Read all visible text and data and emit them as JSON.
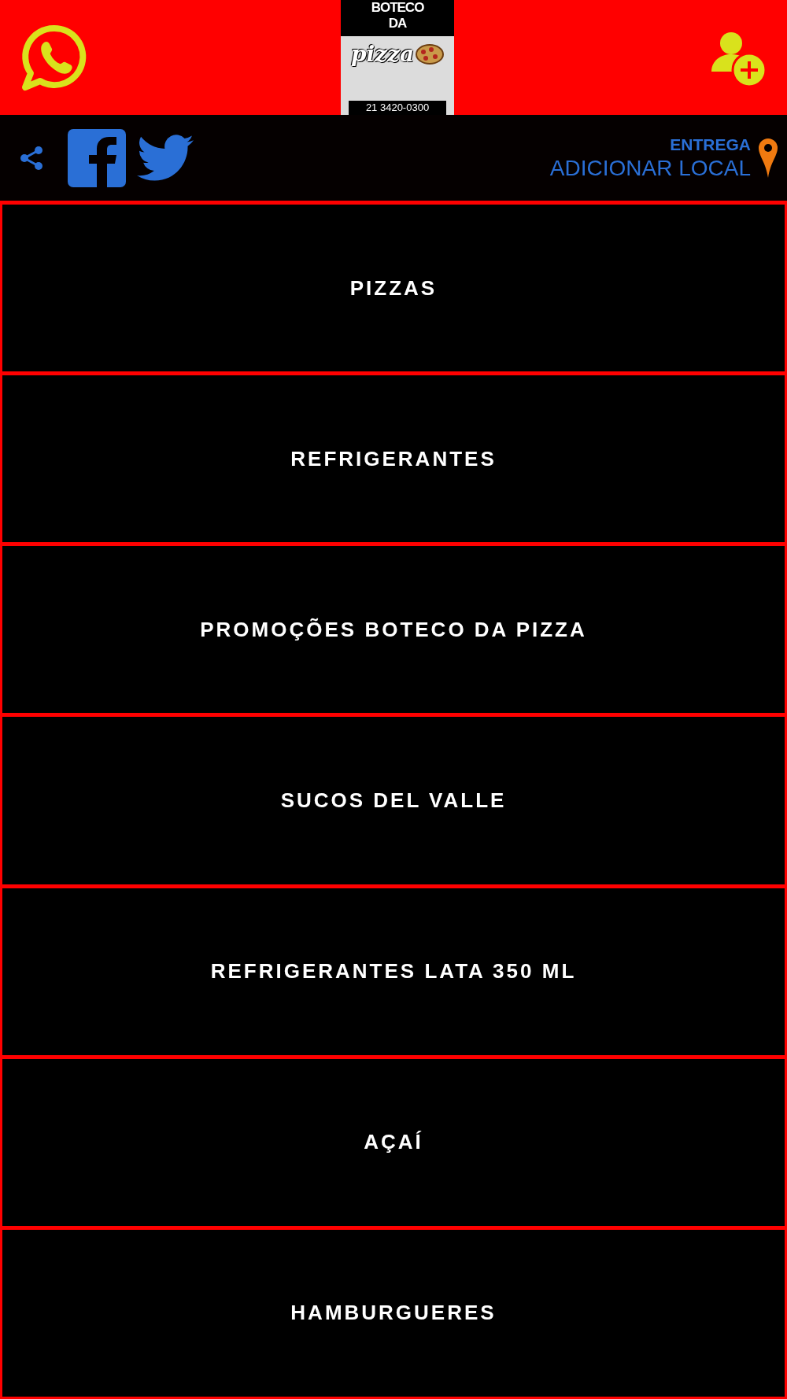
{
  "header": {
    "logo": {
      "top_lines": [
        "BOTECO",
        "DA"
      ],
      "wordmark": "pizza",
      "phone": "21 3420-0300"
    }
  },
  "social_bar": {
    "delivery_label": "ENTREGA",
    "delivery_action": "ADICIONAR LOCAL"
  },
  "categories": [
    {
      "label": "PIZZAS"
    },
    {
      "label": "REFRIGERANTES"
    },
    {
      "label": "PROMOÇÕES BOTECO DA PIZZA"
    },
    {
      "label": "SUCOS DEL VALLE"
    },
    {
      "label": "REFRIGERANTES LATA 350 ML"
    },
    {
      "label": "AÇAÍ"
    },
    {
      "label": "HAMBURGUERES"
    }
  ]
}
